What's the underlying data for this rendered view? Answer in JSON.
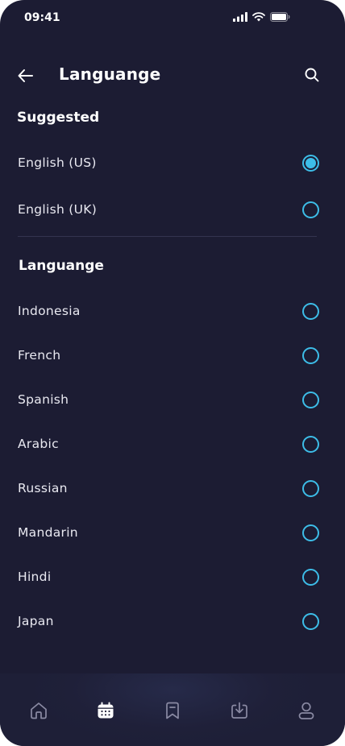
{
  "status": {
    "time": "09:41"
  },
  "header": {
    "title": "Languange"
  },
  "suggested": {
    "title": "Suggested",
    "items": [
      {
        "label": "English (US)",
        "selected": true
      },
      {
        "label": "English (UK)",
        "selected": false
      }
    ]
  },
  "languages": {
    "title": "Languange",
    "items": [
      {
        "label": "Indonesia"
      },
      {
        "label": "French"
      },
      {
        "label": "Spanish"
      },
      {
        "label": "Arabic"
      },
      {
        "label": "Russian"
      },
      {
        "label": "Mandarin"
      },
      {
        "label": "Hindi"
      },
      {
        "label": "Japan"
      }
    ]
  },
  "nav": {
    "items": [
      {
        "icon": "home-icon",
        "active": false
      },
      {
        "icon": "calendar-icon",
        "active": true
      },
      {
        "icon": "bookmark-icon",
        "active": false
      },
      {
        "icon": "download-icon",
        "active": false
      },
      {
        "icon": "profile-icon",
        "active": false
      }
    ]
  },
  "colors": {
    "background": "#1c1c33",
    "accent": "#3dbde8",
    "text": "#ffffff",
    "nav_inactive": "#8a8aa3"
  }
}
